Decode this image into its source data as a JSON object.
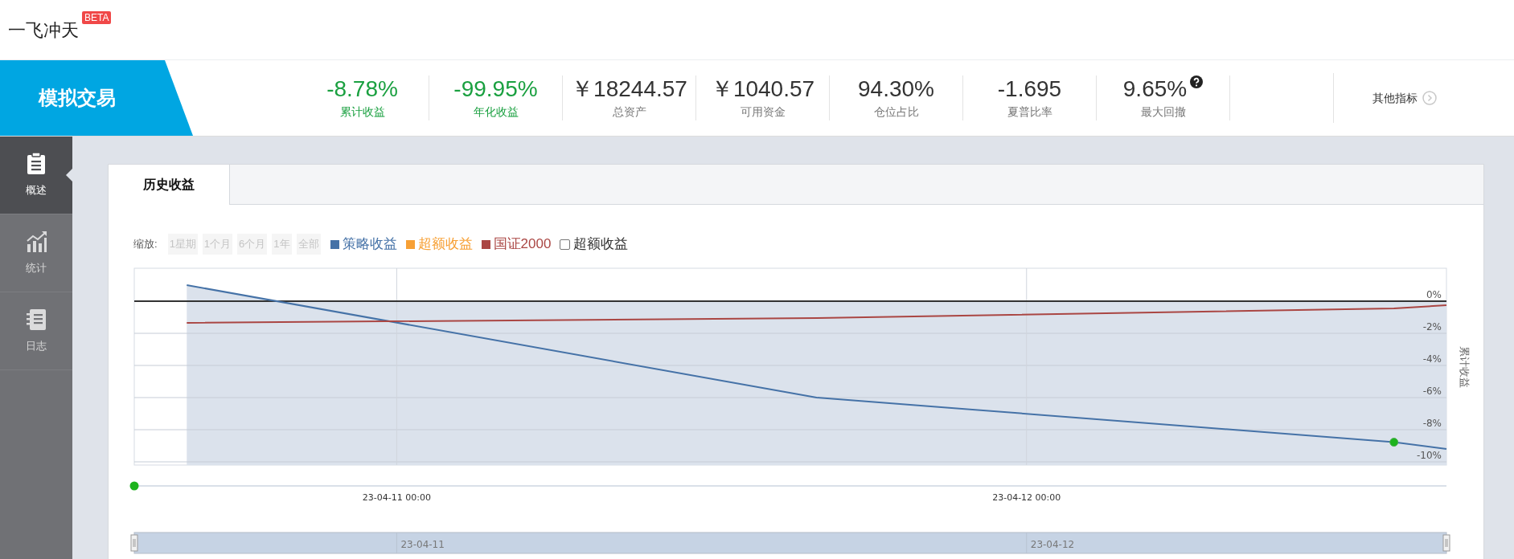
{
  "header": {
    "logo": "一飞冲天",
    "badge": "BETA"
  },
  "banner": {
    "title": "模拟交易"
  },
  "stats": [
    {
      "kind": "plain",
      "value": "-8.78%",
      "label": "累计收益",
      "color": "#1aa040"
    },
    {
      "kind": "plain",
      "value": "-99.95%",
      "label": "年化收益",
      "color": "#1aa040"
    },
    {
      "kind": "plain",
      "value": "￥18244.57",
      "label": "总资产",
      "color": "#333333"
    },
    {
      "kind": "plain",
      "value": "￥1040.57",
      "label": "可用资金",
      "color": "#333333"
    },
    {
      "kind": "plain",
      "value": "94.30%",
      "label": "仓位占比",
      "color": "#333333"
    },
    {
      "kind": "plain",
      "value": "-1.695",
      "label": "夏普比率",
      "color": "#333333"
    },
    {
      "kind": "help",
      "value": "9.65%",
      "label": "最大回撤",
      "color": "#333333"
    }
  ],
  "more_link": "其他指标",
  "sidebar": {
    "items": [
      {
        "label": "概述",
        "selected": true
      },
      {
        "label": "统计",
        "selected": false
      },
      {
        "label": "日志",
        "selected": false
      }
    ]
  },
  "tabs": [
    {
      "label": "历史收益",
      "selected": true
    }
  ],
  "zoom": {
    "label": "缩放:",
    "buttons": [
      {
        "label": "1星期",
        "disabled": true
      },
      {
        "label": "1个月",
        "disabled": true
      },
      {
        "label": "6个月",
        "disabled": true
      },
      {
        "label": "1年",
        "disabled": true
      },
      {
        "label": "全部",
        "disabled": true
      }
    ]
  },
  "legend_checkbox": {
    "label": "超额收益",
    "checked": false
  },
  "chart_data": {
    "type": "line",
    "grid": true,
    "ylabel": "累计收益",
    "ylim": [
      -10.2,
      2.05
    ],
    "categories": [
      null,
      null,
      null,
      null,
      null,
      null,
      null,
      null,
      null,
      null,
      "23-04-11 00:00",
      null,
      null,
      null,
      null,
      null,
      null,
      null,
      null,
      null,
      null,
      null,
      null,
      null,
      null,
      null,
      null,
      null,
      null,
      null,
      null,
      null,
      null,
      null,
      "23-04-12 00:00",
      null,
      null,
      null,
      null,
      null,
      null,
      null,
      null,
      null,
      null,
      null,
      null,
      null,
      null,
      null,
      null
    ],
    "yticks": [
      {
        "value": 0,
        "label": "0%"
      },
      {
        "value": -2,
        "label": "-2%"
      },
      {
        "value": -4,
        "label": "-4%"
      },
      {
        "value": -6,
        "label": "-6%"
      },
      {
        "value": -8,
        "label": "-8%"
      },
      {
        "value": -10,
        "label": "-10%"
      }
    ],
    "series": [
      {
        "name": "策略收益",
        "color": "#4572a7",
        "values": [
          null,
          null,
          1.0,
          null,
          null,
          null,
          null,
          null,
          null,
          null,
          null,
          null,
          null,
          null,
          null,
          null,
          null,
          null,
          null,
          null,
          null,
          null,
          null,
          null,
          null,
          null,
          -6.0,
          null,
          null,
          null,
          null,
          null,
          null,
          null,
          null,
          null,
          null,
          null,
          null,
          null,
          null,
          null,
          null,
          null,
          null,
          null,
          null,
          null,
          -8.78,
          null,
          -9.2
        ]
      },
      {
        "name": "超额收益",
        "color": "#f7a035",
        "values": [
          null,
          null,
          null,
          null,
          null,
          null,
          null,
          null,
          null,
          null,
          null,
          null,
          null,
          null,
          null,
          null,
          null,
          null,
          null,
          null,
          null,
          null,
          null,
          null,
          null,
          null,
          null,
          null,
          null,
          null,
          null,
          null,
          null,
          null,
          null,
          null,
          null,
          null,
          null,
          null,
          null,
          null,
          null,
          null,
          null,
          null,
          null,
          null,
          null,
          null,
          null
        ]
      },
      {
        "name": "国证2000",
        "color": "#aa4643",
        "values": [
          null,
          null,
          -1.35,
          null,
          null,
          null,
          null,
          null,
          null,
          null,
          null,
          null,
          null,
          null,
          null,
          null,
          null,
          null,
          null,
          null,
          null,
          null,
          null,
          null,
          null,
          null,
          -1.05,
          null,
          null,
          null,
          null,
          null,
          null,
          null,
          null,
          null,
          null,
          null,
          null,
          null,
          null,
          null,
          null,
          null,
          null,
          null,
          null,
          null,
          -0.45,
          null,
          -0.25
        ]
      }
    ]
  },
  "navigator": {
    "labels": [
      "23-04-11",
      "23-04-12"
    ]
  }
}
